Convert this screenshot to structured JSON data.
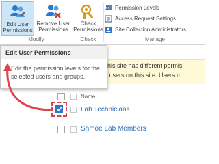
{
  "ribbon": {
    "edit_user_permissions": "Edit User\nPermissions",
    "remove_user_permissions": "Remove User\nPermissions",
    "check_permissions": "Check\nPermissions",
    "permission_levels": "Permission Levels",
    "access_request_settings": "Access Request Settings",
    "site_collection_administrators": "Site Collection Administrators",
    "groups": {
      "modify": "Modify",
      "check": "Check",
      "manage": "Manage"
    }
  },
  "tooltip": {
    "title": "Edit User Permissions",
    "description": "Edit the permission levels for the selected users and groups."
  },
  "notice": {
    "line1": "his site has different permis",
    "line2": " users on this site. Users m"
  },
  "list": {
    "header": "Name",
    "rows": [
      {
        "label": "Lab Technicians",
        "checked": true
      },
      {
        "label": "Shmoe Lab Members",
        "checked": false
      }
    ]
  },
  "colors": {
    "accent": "#2b77c9",
    "highlight": "#e0414a",
    "notice_bg": "#fef9d7",
    "active_button": "#cde6f7"
  }
}
